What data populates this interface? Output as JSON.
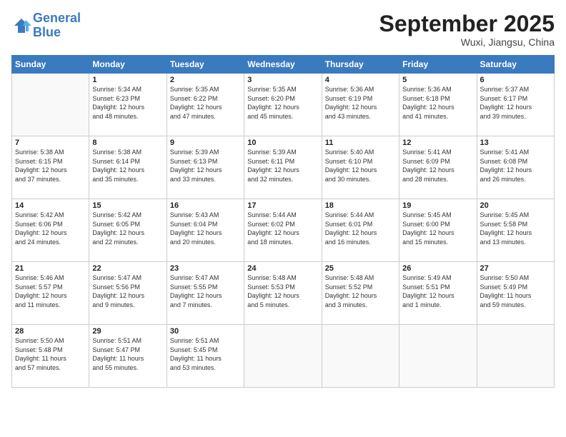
{
  "logo": {
    "line1": "General",
    "line2": "Blue"
  },
  "title": "September 2025",
  "location": "Wuxi, Jiangsu, China",
  "days_of_week": [
    "Sunday",
    "Monday",
    "Tuesday",
    "Wednesday",
    "Thursday",
    "Friday",
    "Saturday"
  ],
  "weeks": [
    [
      {
        "num": "",
        "info": ""
      },
      {
        "num": "1",
        "info": "Sunrise: 5:34 AM\nSunset: 6:23 PM\nDaylight: 12 hours\nand 48 minutes."
      },
      {
        "num": "2",
        "info": "Sunrise: 5:35 AM\nSunset: 6:22 PM\nDaylight: 12 hours\nand 47 minutes."
      },
      {
        "num": "3",
        "info": "Sunrise: 5:35 AM\nSunset: 6:20 PM\nDaylight: 12 hours\nand 45 minutes."
      },
      {
        "num": "4",
        "info": "Sunrise: 5:36 AM\nSunset: 6:19 PM\nDaylight: 12 hours\nand 43 minutes."
      },
      {
        "num": "5",
        "info": "Sunrise: 5:36 AM\nSunset: 6:18 PM\nDaylight: 12 hours\nand 41 minutes."
      },
      {
        "num": "6",
        "info": "Sunrise: 5:37 AM\nSunset: 6:17 PM\nDaylight: 12 hours\nand 39 minutes."
      }
    ],
    [
      {
        "num": "7",
        "info": "Sunrise: 5:38 AM\nSunset: 6:15 PM\nDaylight: 12 hours\nand 37 minutes."
      },
      {
        "num": "8",
        "info": "Sunrise: 5:38 AM\nSunset: 6:14 PM\nDaylight: 12 hours\nand 35 minutes."
      },
      {
        "num": "9",
        "info": "Sunrise: 5:39 AM\nSunset: 6:13 PM\nDaylight: 12 hours\nand 33 minutes."
      },
      {
        "num": "10",
        "info": "Sunrise: 5:39 AM\nSunset: 6:11 PM\nDaylight: 12 hours\nand 32 minutes."
      },
      {
        "num": "11",
        "info": "Sunrise: 5:40 AM\nSunset: 6:10 PM\nDaylight: 12 hours\nand 30 minutes."
      },
      {
        "num": "12",
        "info": "Sunrise: 5:41 AM\nSunset: 6:09 PM\nDaylight: 12 hours\nand 28 minutes."
      },
      {
        "num": "13",
        "info": "Sunrise: 5:41 AM\nSunset: 6:08 PM\nDaylight: 12 hours\nand 26 minutes."
      }
    ],
    [
      {
        "num": "14",
        "info": "Sunrise: 5:42 AM\nSunset: 6:06 PM\nDaylight: 12 hours\nand 24 minutes."
      },
      {
        "num": "15",
        "info": "Sunrise: 5:42 AM\nSunset: 6:05 PM\nDaylight: 12 hours\nand 22 minutes."
      },
      {
        "num": "16",
        "info": "Sunrise: 5:43 AM\nSunset: 6:04 PM\nDaylight: 12 hours\nand 20 minutes."
      },
      {
        "num": "17",
        "info": "Sunrise: 5:44 AM\nSunset: 6:02 PM\nDaylight: 12 hours\nand 18 minutes."
      },
      {
        "num": "18",
        "info": "Sunrise: 5:44 AM\nSunset: 6:01 PM\nDaylight: 12 hours\nand 16 minutes."
      },
      {
        "num": "19",
        "info": "Sunrise: 5:45 AM\nSunset: 6:00 PM\nDaylight: 12 hours\nand 15 minutes."
      },
      {
        "num": "20",
        "info": "Sunrise: 5:45 AM\nSunset: 5:58 PM\nDaylight: 12 hours\nand 13 minutes."
      }
    ],
    [
      {
        "num": "21",
        "info": "Sunrise: 5:46 AM\nSunset: 5:57 PM\nDaylight: 12 hours\nand 11 minutes."
      },
      {
        "num": "22",
        "info": "Sunrise: 5:47 AM\nSunset: 5:56 PM\nDaylight: 12 hours\nand 9 minutes."
      },
      {
        "num": "23",
        "info": "Sunrise: 5:47 AM\nSunset: 5:55 PM\nDaylight: 12 hours\nand 7 minutes."
      },
      {
        "num": "24",
        "info": "Sunrise: 5:48 AM\nSunset: 5:53 PM\nDaylight: 12 hours\nand 5 minutes."
      },
      {
        "num": "25",
        "info": "Sunrise: 5:48 AM\nSunset: 5:52 PM\nDaylight: 12 hours\nand 3 minutes."
      },
      {
        "num": "26",
        "info": "Sunrise: 5:49 AM\nSunset: 5:51 PM\nDaylight: 12 hours\nand 1 minute."
      },
      {
        "num": "27",
        "info": "Sunrise: 5:50 AM\nSunset: 5:49 PM\nDaylight: 11 hours\nand 59 minutes."
      }
    ],
    [
      {
        "num": "28",
        "info": "Sunrise: 5:50 AM\nSunset: 5:48 PM\nDaylight: 11 hours\nand 57 minutes."
      },
      {
        "num": "29",
        "info": "Sunrise: 5:51 AM\nSunset: 5:47 PM\nDaylight: 11 hours\nand 55 minutes."
      },
      {
        "num": "30",
        "info": "Sunrise: 5:51 AM\nSunset: 5:45 PM\nDaylight: 11 hours\nand 53 minutes."
      },
      {
        "num": "",
        "info": ""
      },
      {
        "num": "",
        "info": ""
      },
      {
        "num": "",
        "info": ""
      },
      {
        "num": "",
        "info": ""
      }
    ]
  ]
}
